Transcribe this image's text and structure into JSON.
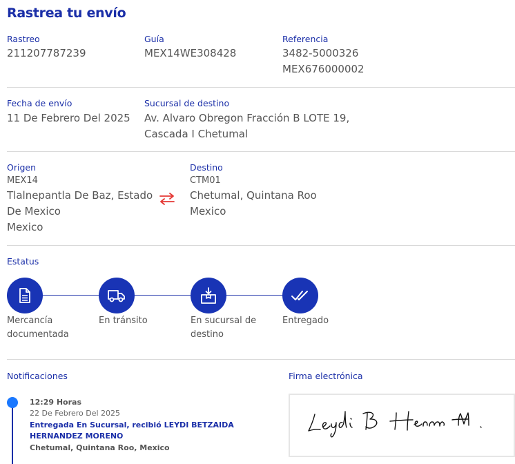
{
  "page": {
    "title": "Rastrea tu envío"
  },
  "summary": {
    "rastreo_label": "Rastreo",
    "rastreo_value": "211207787239",
    "guia_label": "Guía",
    "guia_value": "MEX14WE308428",
    "referencia_label": "Referencia",
    "referencia_value_1": "3482-5000326",
    "referencia_value_2": "MEX676000002"
  },
  "shipping": {
    "fecha_label": "Fecha de envío",
    "fecha_value": "11 De Febrero Del 2025",
    "sucursal_label": "Sucursal de destino",
    "sucursal_line_1": "Av. Alvaro Obregon Fracción B LOTE 19,",
    "sucursal_line_2": "Cascada I Chetumal"
  },
  "route": {
    "origen_label": "Origen",
    "origen_code": "MEX14",
    "origen_line_1": "Tlalnepantla De Baz, Estado",
    "origen_line_2": "De Mexico",
    "origen_line_3": "Mexico",
    "destino_label": "Destino",
    "destino_code": "CTM01",
    "destino_line_1": "Chetumal, Quintana Roo",
    "destino_line_2": "Mexico",
    "swap_icon": "swap-arrows-icon"
  },
  "status": {
    "label": "Estatus",
    "steps": [
      {
        "line_1": "Mercancía",
        "line_2": "documentada",
        "icon": "document-icon"
      },
      {
        "line_1": "En tránsito",
        "line_2": "",
        "icon": "truck-icon"
      },
      {
        "line_1": "En sucursal de",
        "line_2": "destino",
        "icon": "package-icon"
      },
      {
        "line_1": "Entregado",
        "line_2": "",
        "icon": "double-check-icon"
      }
    ],
    "accent": "#1934b5"
  },
  "notifications": {
    "label": "Notificaciones",
    "items": [
      {
        "time": "12:29 Horas",
        "date": "22 De Febrero Del 2025",
        "message": "Entregada En Sucursal, recibió LEYDI BETZAIDA HERNANDEZ MORENO",
        "location": "Chetumal, Quintana Roo, Mexico"
      }
    ]
  },
  "signature": {
    "label": "Firma electrónica",
    "text": "Leydi B Hern M."
  },
  "colors": {
    "brand": "#1b2fa8",
    "timeline_dot": "#1a78ff",
    "swap": "#e53935"
  }
}
